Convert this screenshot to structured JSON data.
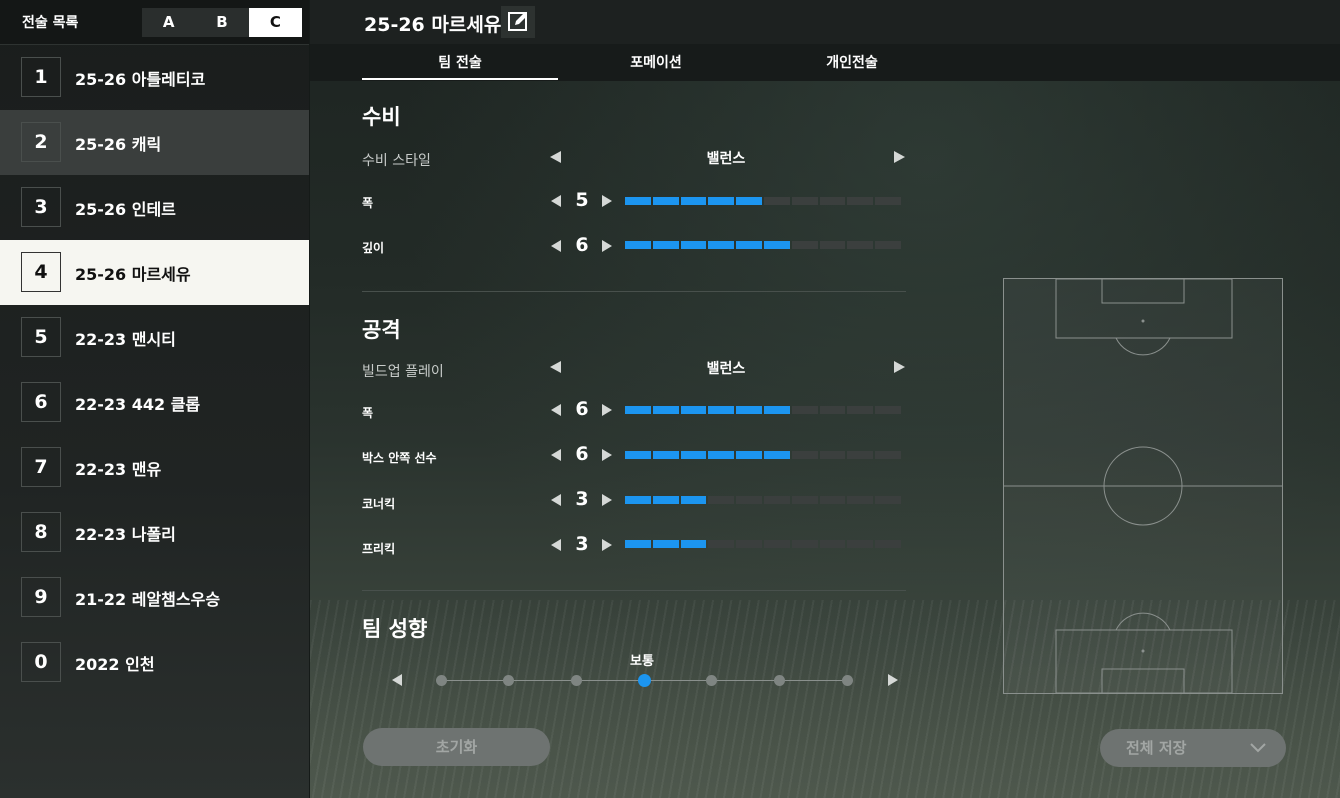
{
  "sidebar": {
    "title": "전술 목록",
    "sets": [
      "A",
      "B",
      "C"
    ],
    "active_set": "C",
    "items": [
      {
        "num": "1",
        "name": "25-26 아틀레티코"
      },
      {
        "num": "2",
        "name": "25-26 캐릭"
      },
      {
        "num": "3",
        "name": "25-26 인테르"
      },
      {
        "num": "4",
        "name": "25-26 마르세유"
      },
      {
        "num": "5",
        "name": "22-23 맨시티"
      },
      {
        "num": "6",
        "name": "22-23 442 클롭"
      },
      {
        "num": "7",
        "name": "22-23 맨유"
      },
      {
        "num": "8",
        "name": "22-23 나폴리"
      },
      {
        "num": "9",
        "name": "21-22 레알챔스우승"
      },
      {
        "num": "0",
        "name": "2022 인천"
      }
    ],
    "selected_index": 3,
    "hover_index": 1
  },
  "header": {
    "title": "25-26 마르세유",
    "edit_icon": "pencil-edit-icon"
  },
  "tabs": [
    {
      "label": "팀 전술",
      "active": true
    },
    {
      "label": "포메이션",
      "active": false
    },
    {
      "label": "개인전술",
      "active": false
    }
  ],
  "defense": {
    "title": "수비",
    "style_label": "수비 스타일",
    "style_value": "밸런스",
    "width_label": "폭",
    "width_value": 5,
    "depth_label": "깊이",
    "depth_value": 6
  },
  "attack": {
    "title": "공격",
    "buildup_label": "빌드업 플레이",
    "buildup_value": "밸런스",
    "width_label": "폭",
    "width_value": 6,
    "box_label": "박스 안쪽 선수",
    "box_value": 6,
    "corner_label": "코너킥",
    "corner_value": 3,
    "freekick_label": "프리킥",
    "freekick_value": 3
  },
  "tendency": {
    "title": "팀 성향",
    "value_label": "보통",
    "steps": 7,
    "selected_step": 3
  },
  "buttons": {
    "reset": "초기화",
    "save_all": "전체 저장"
  },
  "colors": {
    "accent": "#1c95f0",
    "selected_row": "#f6f6f1",
    "inactive_segment": "#3b3f3e"
  }
}
